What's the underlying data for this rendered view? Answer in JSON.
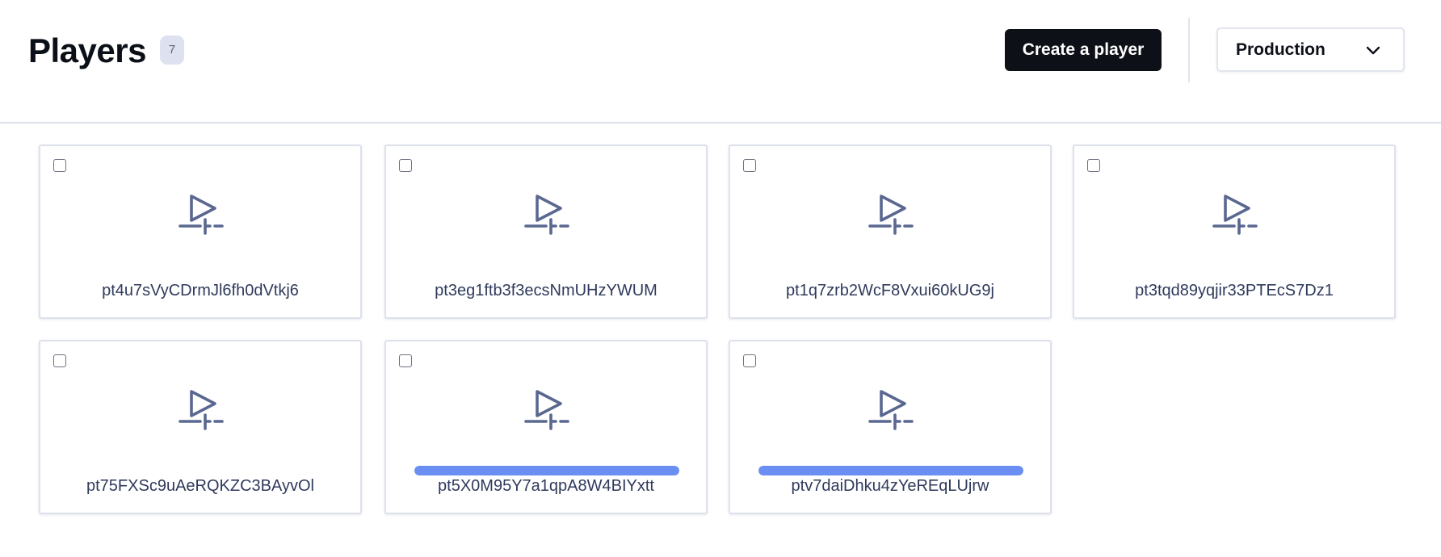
{
  "header": {
    "title": "Players",
    "count": "7",
    "create_label": "Create a player",
    "environment": "Production"
  },
  "icons": {
    "player": "player-icon",
    "dropdown": "chevron-down-icon"
  },
  "colors": {
    "accent": "#6b8ef2",
    "icon": "#5a6891",
    "primary_button": "#0d1117"
  },
  "players": [
    {
      "id": "pt4u7sVyCDrmJl6fh0dVtkj6",
      "progress": null
    },
    {
      "id": "pt3eg1ftb3f3ecsNmUHzYWUM",
      "progress": null
    },
    {
      "id": "pt1q7zrb2WcF8Vxui60kUG9j",
      "progress": null
    },
    {
      "id": "pt3tqd89yqjir33PTEcS7Dz1",
      "progress": null
    },
    {
      "id": "pt75FXSc9uAeRQKZC3BAyvOl",
      "progress": null
    },
    {
      "id": "pt5X0M95Y7a1qpA8W4BIYxtt",
      "progress": 1.0
    },
    {
      "id": "ptv7daiDhku4zYeREqLUjrw",
      "progress": 1.0
    }
  ]
}
